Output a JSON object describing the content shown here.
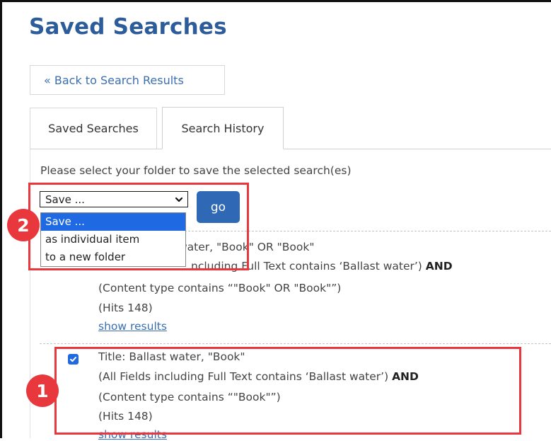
{
  "page": {
    "title": "Saved Searches"
  },
  "back_button": {
    "label": "« Back to Search Results"
  },
  "tabs": [
    {
      "label": "Saved Searches"
    },
    {
      "label": "Search History"
    }
  ],
  "instruction": "Please select your folder to save the selected search(es)",
  "save_select": {
    "value": "Save ...",
    "options": [
      "Save ...",
      "as individual item",
      "to a new folder"
    ],
    "selected_index": 0
  },
  "go_button": {
    "label": "go"
  },
  "callouts": [
    "2",
    "1"
  ],
  "searches": [
    {
      "checked": false,
      "title_fragment": "water, \"Book\" OR \"Book\"",
      "criteria_fragment": "ncluding Full Text contains ‘Ballast water’)",
      "and_label": "AND",
      "content_type": "(Content type contains “\"Book\" OR \"Book\"”)",
      "hits": "(Hits 148)",
      "link": "show results"
    },
    {
      "checked": true,
      "title": "Title: Ballast water, \"Book\"",
      "criteria": "(All Fields including Full Text contains ‘Ballast water’)",
      "and_label": "AND",
      "content_type": "(Content type contains “\"Book\"”)",
      "hits": "(Hits 148)",
      "link": "show results"
    }
  ],
  "colors": {
    "title": "#2d5c9a",
    "link": "#3b6fb0",
    "button": "#2f68b4",
    "highlight": "#1f6ae3",
    "callout": "#e8383d"
  },
  "icons": {
    "select_chevron": "chevron-down-icon",
    "checkbox": "checkmark-icon"
  }
}
